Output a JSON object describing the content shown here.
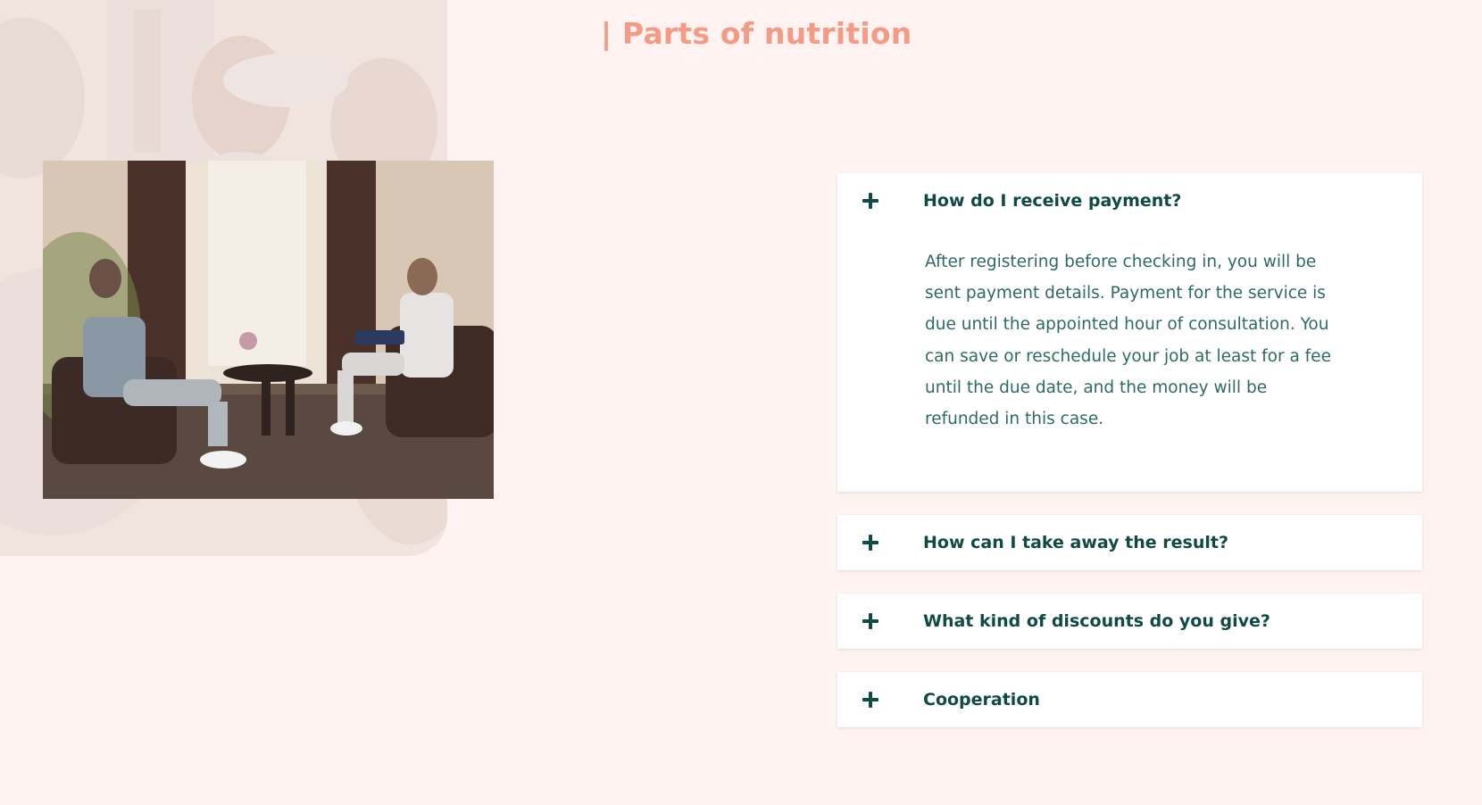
{
  "section": {
    "title": "| Parts of nutrition"
  },
  "images": {
    "background_photo": "faded-group-photo",
    "main_photo": "consultation-photo"
  },
  "faq": {
    "items": [
      {
        "question": "How do I receive payment?",
        "expanded": true,
        "toggle_icon": "plus-icon",
        "answer": "After registering before checking in, you will be sent payment details. Payment for the service is due until the appointed hour of consultation. You can save or reschedule your job at least for a fee until the due date, and the money will be refunded in this case."
      },
      {
        "question": "How can I take away the result?",
        "expanded": false,
        "toggle_icon": "plus-icon"
      },
      {
        "question": "What kind of discounts do you give?",
        "expanded": false,
        "toggle_icon": "plus-icon"
      },
      {
        "question": "Cooperation",
        "expanded": false,
        "toggle_icon": "plus-icon"
      }
    ]
  },
  "colors": {
    "background": "#fff3f1",
    "accent": "#f59a84",
    "heading_text": "#0f4a44",
    "body_text": "#2f6a63",
    "card": "#ffffff"
  }
}
